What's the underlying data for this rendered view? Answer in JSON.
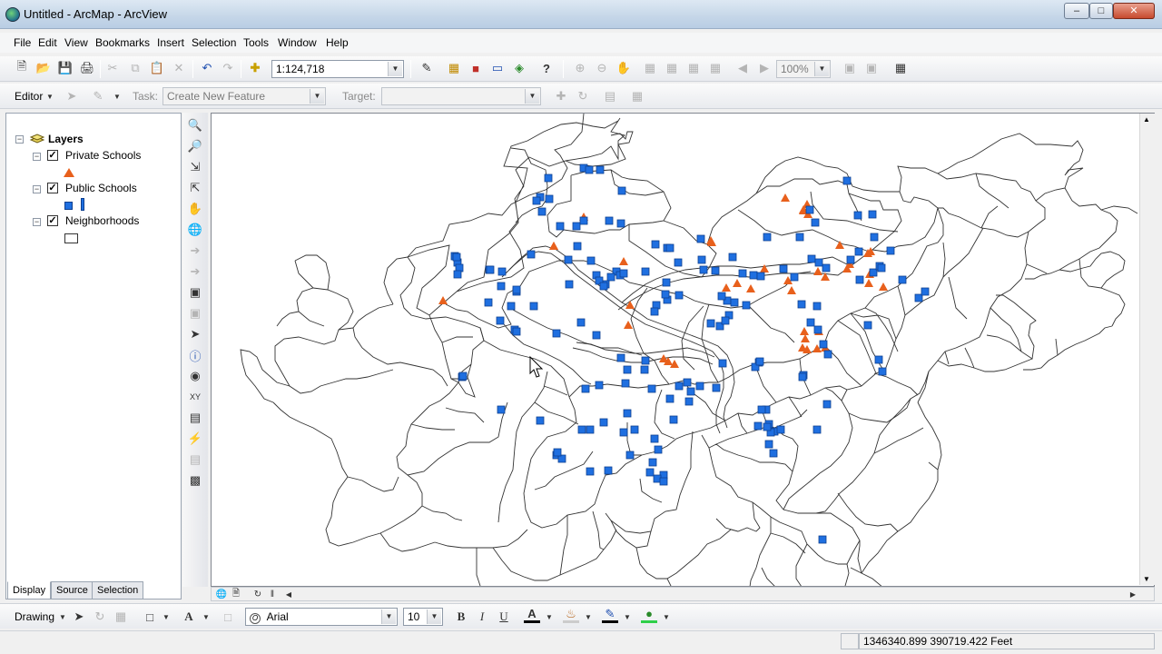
{
  "window": {
    "title": "Untitled - ArcMap - ArcView"
  },
  "menu": [
    "File",
    "Edit",
    "View",
    "Bookmarks",
    "Insert",
    "Selection",
    "Tools",
    "Window",
    "Help"
  ],
  "standard_toolbar": {
    "scale": "1:124,718",
    "zoom_percent": "100%"
  },
  "editor_toolbar": {
    "editor_label": "Editor",
    "task_label": "Task:",
    "task_value": "Create New Feature",
    "target_label": "Target:",
    "target_value": ""
  },
  "toc": {
    "root": "Layers",
    "layers": [
      {
        "name": "Private Schools",
        "checked": true,
        "symbol": "orange-triangle",
        "color": "#e8601c"
      },
      {
        "name": "Public Schools",
        "checked": true,
        "symbol": "blue-square",
        "color": "#1f6fe0"
      },
      {
        "name": "Neighborhoods",
        "checked": true,
        "symbol": "hollow-rectangle",
        "color": "#ffffff"
      }
    ],
    "tabs": [
      "Display",
      "Source",
      "Selection"
    ],
    "active_tab": "Display"
  },
  "drawing_toolbar": {
    "drawing_label": "Drawing",
    "font": "Arial",
    "font_size": "10",
    "bold": "B",
    "italic": "I",
    "underline": "U",
    "font_color_glyph": "A"
  },
  "status": {
    "coordinates": "1346340.899  390719.422 Feet"
  },
  "icons": [
    "new-icon",
    "open-icon",
    "save-icon",
    "print-icon",
    "cut-icon",
    "copy-icon",
    "paste-icon",
    "delete-icon",
    "undo-icon",
    "redo-icon",
    "add-data-icon",
    "zoom-in-icon",
    "zoom-out-icon",
    "full-extent-icon",
    "pan-icon",
    "globe-icon",
    "back-icon",
    "forward-icon",
    "select-icon",
    "identify-icon",
    "find-icon",
    "xy-icon",
    "measure-icon",
    "hyperlink-icon"
  ],
  "colors": {
    "public_school": "#1f6fe0",
    "private_school": "#e8601c",
    "map_background": "#ffffff",
    "neighborhood_outline": "#333333"
  }
}
